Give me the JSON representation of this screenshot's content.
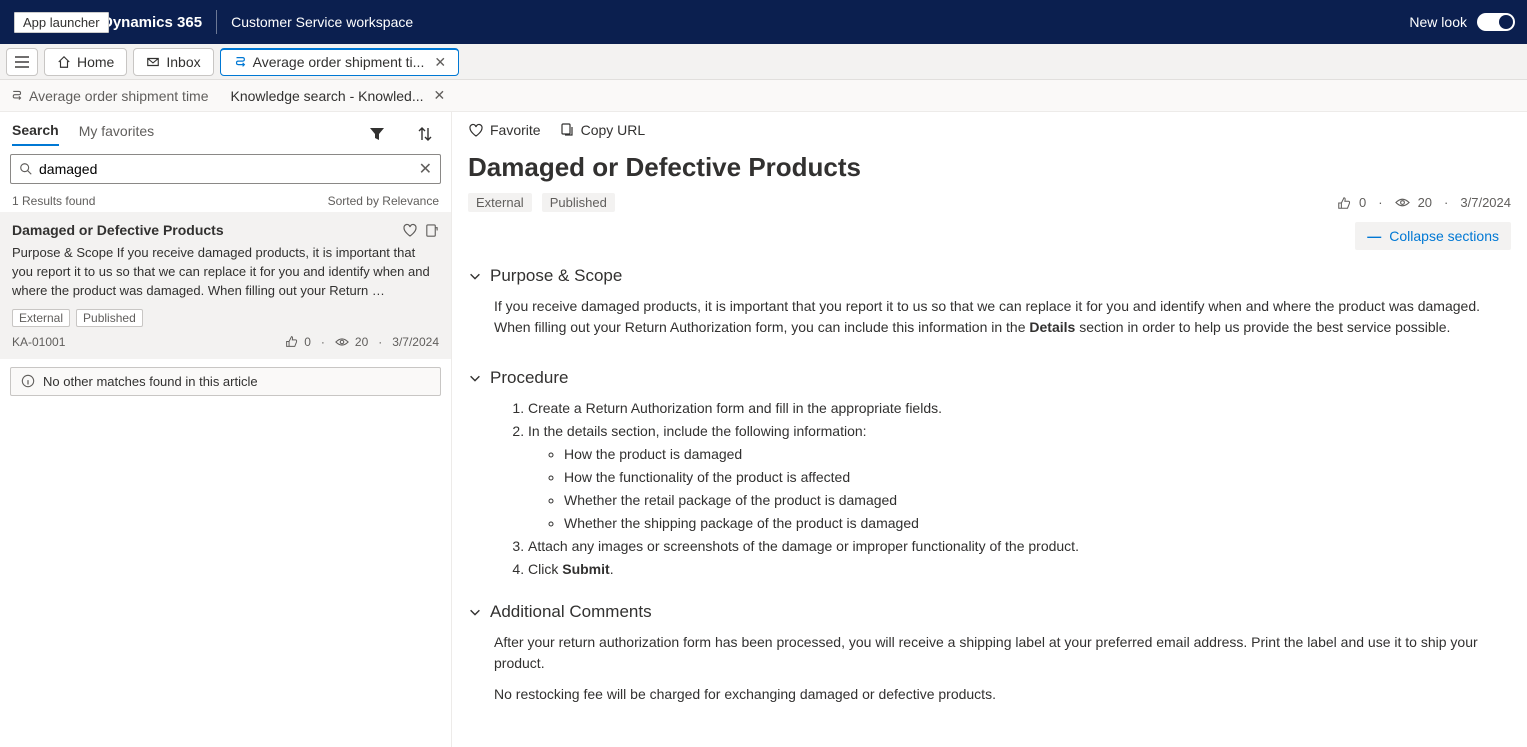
{
  "topbar": {
    "app_launcher_tooltip": "App launcher",
    "brand": "Dynamics 365",
    "workspace": "Customer Service workspace",
    "new_look_label": "New look"
  },
  "tabs": {
    "home": "Home",
    "inbox": "Inbox",
    "case_tab": "Average order shipment ti..."
  },
  "subtabs": {
    "case": "Average order shipment time",
    "knowledge": "Knowledge search - Knowled..."
  },
  "leftpane": {
    "tab_search": "Search",
    "tab_favorites": "My favorites",
    "search_value": "damaged",
    "results_found": "1 Results found",
    "sorted_by": "Sorted by Relevance",
    "result": {
      "title": "Damaged or Defective Products",
      "snippet": "Purpose & Scope If you receive damaged products, it is important that you report it to us so that we can replace it for you and identify when and where the product was damaged. When filling out your Return …",
      "badge_ext": "External",
      "badge_pub": "Published",
      "ka": "KA-01001",
      "likes": "0",
      "views": "20",
      "date": "3/7/2024"
    },
    "no_match": "No other matches found in this article"
  },
  "rightpane": {
    "favorite": "Favorite",
    "copyurl": "Copy URL",
    "title": "Damaged or Defective Products",
    "badge_ext": "External",
    "badge_pub": "Published",
    "likes": "0",
    "views": "20",
    "date": "3/7/2024",
    "collapse": "Collapse sections",
    "sec1_h": "Purpose & Scope",
    "sec1_p_before": "If you receive damaged products, it is important that you report it to us so that we can replace it for you and identify when and where the product was damaged. When filling out your Return Authorization form, you can include this information in the ",
    "sec1_bold": "Details",
    "sec1_p_after": " section in order to help us provide the best service possible.",
    "sec2_h": "Procedure",
    "proc": {
      "s1": "Create a Return Authorization form and fill in the appropriate fields.",
      "s2": "In the details section, include the following information:",
      "s2a": "How the product is damaged",
      "s2b": "How the functionality of the product is affected",
      "s2c": "Whether the retail package of the product is damaged",
      "s2d": "Whether the shipping package of the product is damaged",
      "s3": "Attach any images or screenshots of the damage or improper functionality of the product.",
      "s4_before": "Click ",
      "s4_bold": "Submit",
      "s4_after": "."
    },
    "sec3_h": "Additional Comments",
    "sec3_p1": "After your return authorization form has been processed, you will receive a shipping label at your preferred email address. Print the label and use it to ship your product.",
    "sec3_p2": "No restocking fee will be charged for exchanging damaged or defective products."
  }
}
